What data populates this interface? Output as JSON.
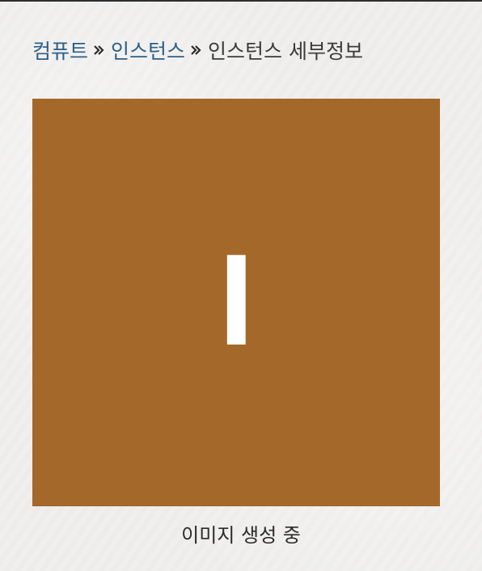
{
  "breadcrumb": {
    "items": [
      {
        "label": "컴퓨트",
        "is_link": true
      },
      {
        "label": "인스턴스",
        "is_link": true
      },
      {
        "label": "인스턴스 세부정보",
        "is_link": false
      }
    ],
    "separator_icon": "double-chevron-right-icon"
  },
  "preview": {
    "letter": "I",
    "background_color": "#a4692a",
    "letter_color": "#ffffff"
  },
  "caption": "이미지 생성 중",
  "colors": {
    "link": "#2c5f86",
    "text": "#3a3a3a",
    "page_background": "#f0efee"
  }
}
